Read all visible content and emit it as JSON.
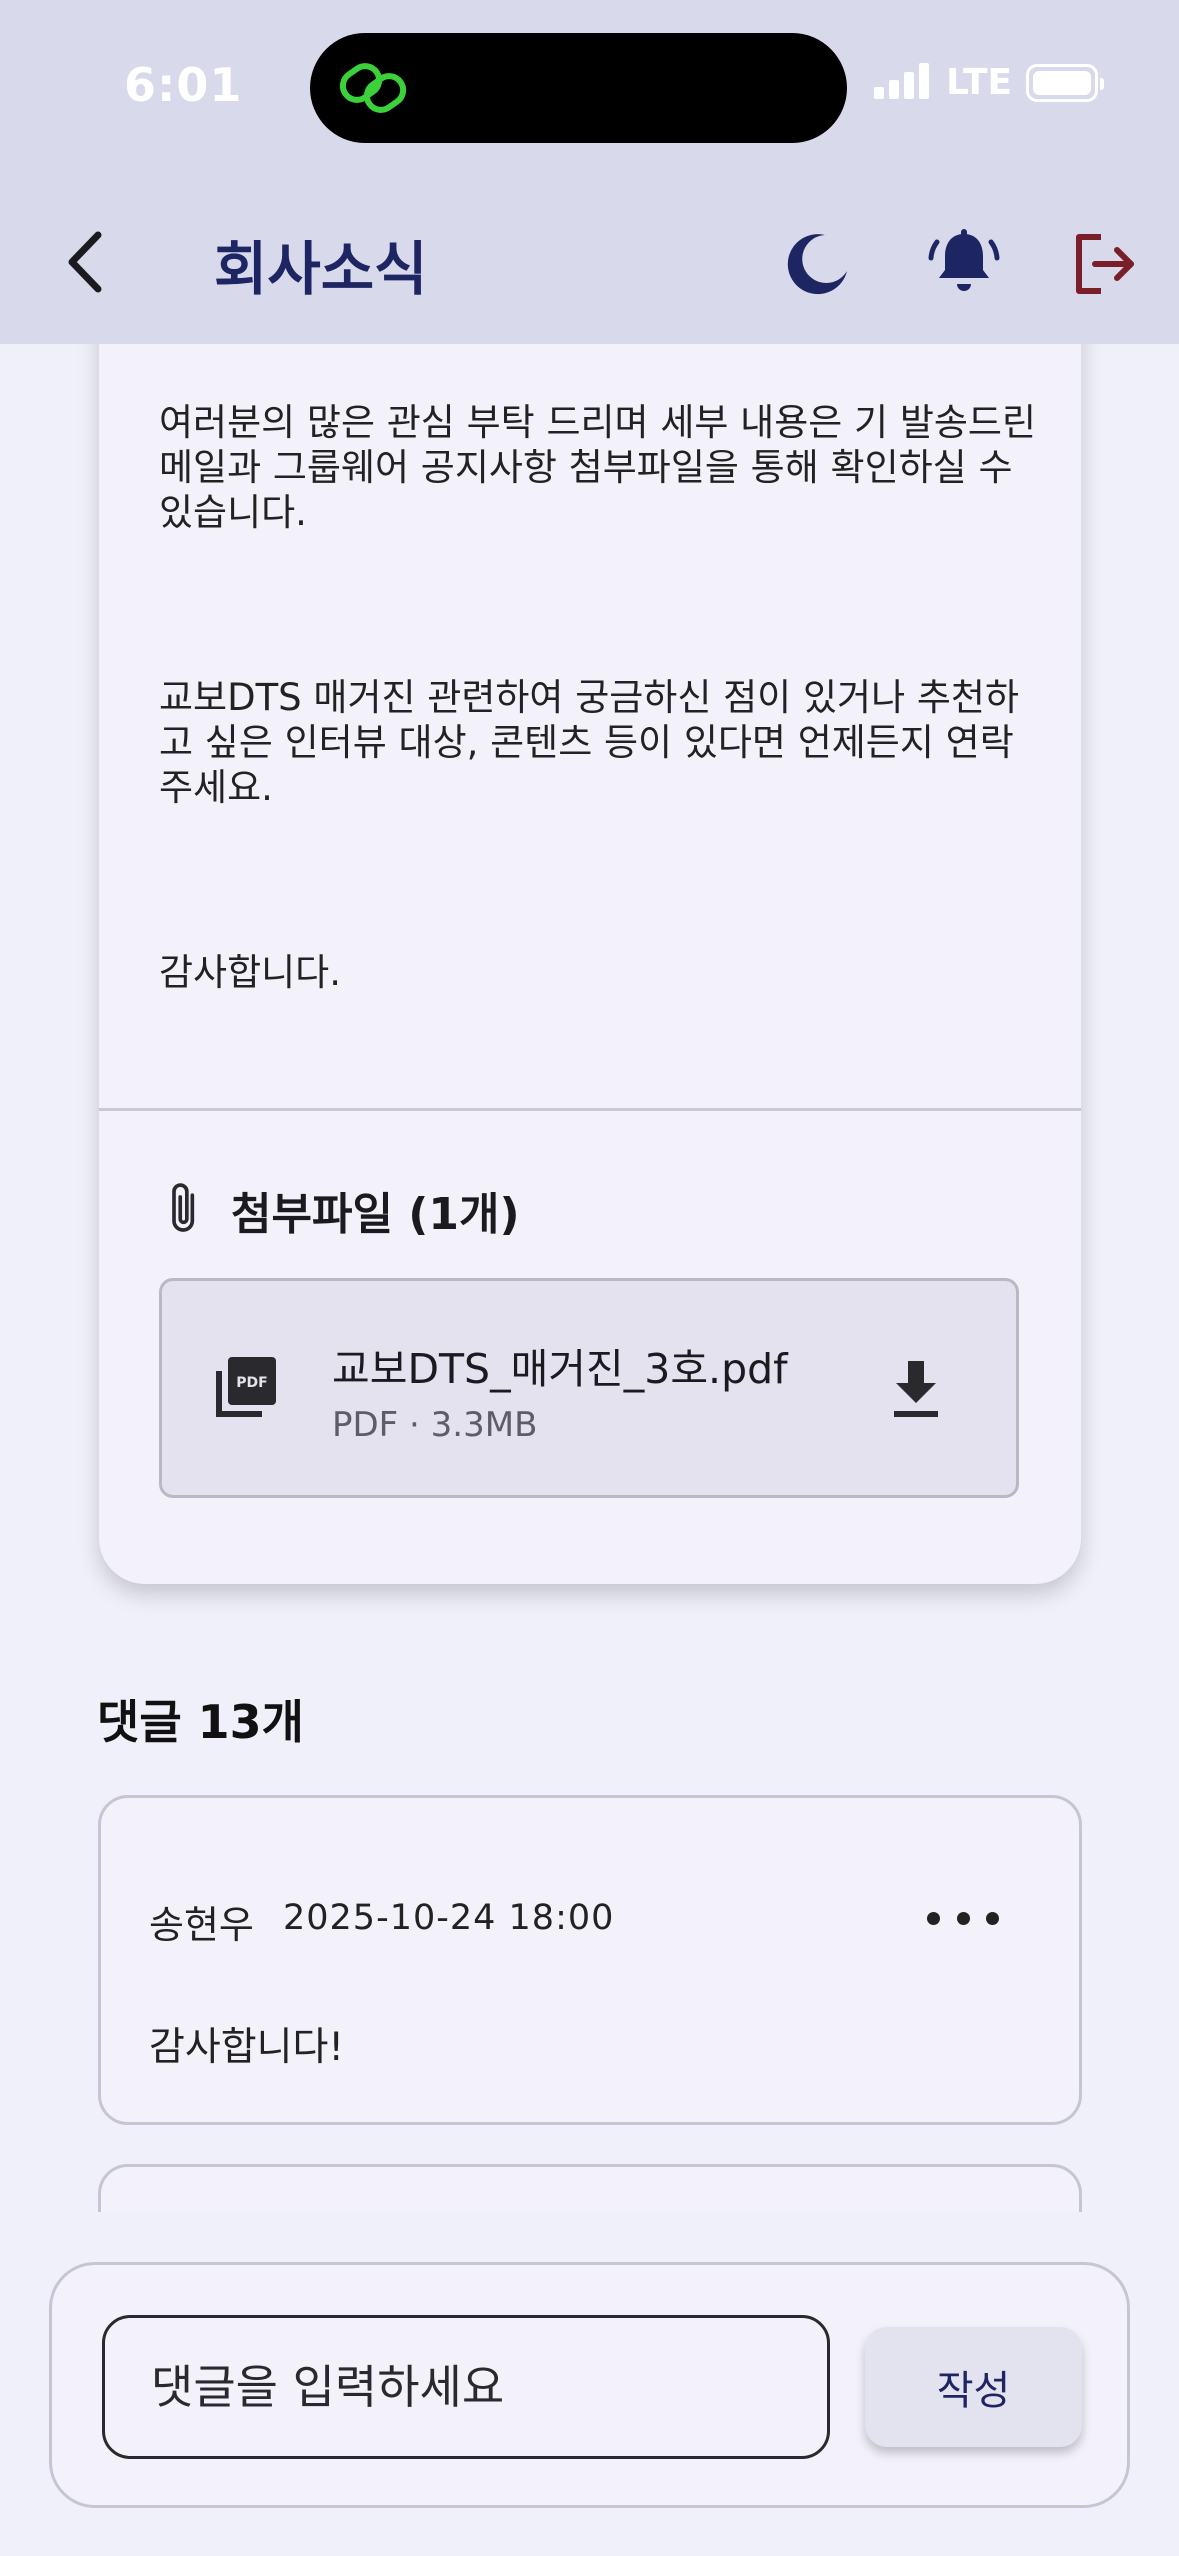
{
  "status_bar": {
    "time": "6:01",
    "network": "LTE"
  },
  "app_bar": {
    "title": "회사소식",
    "icons": [
      "back-icon",
      "moon-icon",
      "bell-icon",
      "logout-icon"
    ],
    "colors": {
      "title": "#1d2662",
      "logout": "#7a1f2a"
    }
  },
  "post": {
    "paragraphs": [
      "여러분의 많은 관심 부탁 드리며 세부 내용은 기 발송드린 메일과 그룹웨어 공지사항 첨부파일을 통해 확인하실 수 있습니다.",
      "교보DTS 매거진 관련하여 궁금하신 점이 있거나 추천하고 싶은 인터뷰 대상, 콘텐츠 등이 있다면 언제든지 연락 주세요.",
      "감사합니다."
    ],
    "attachments_title": "첨부파일 (1개)",
    "file": {
      "name": "교보DTS_매거진_3호.pdf",
      "meta": "PDF · 3.3MB",
      "icon": "pdf-icon"
    }
  },
  "comments": {
    "title": "댓글 13개",
    "items": [
      {
        "author": "송현우",
        "date": "2025-10-24 18:00",
        "text": "감사합니다!"
      }
    ]
  },
  "composer": {
    "placeholder": "댓글을 입력하세요",
    "submit_label": "작성"
  }
}
